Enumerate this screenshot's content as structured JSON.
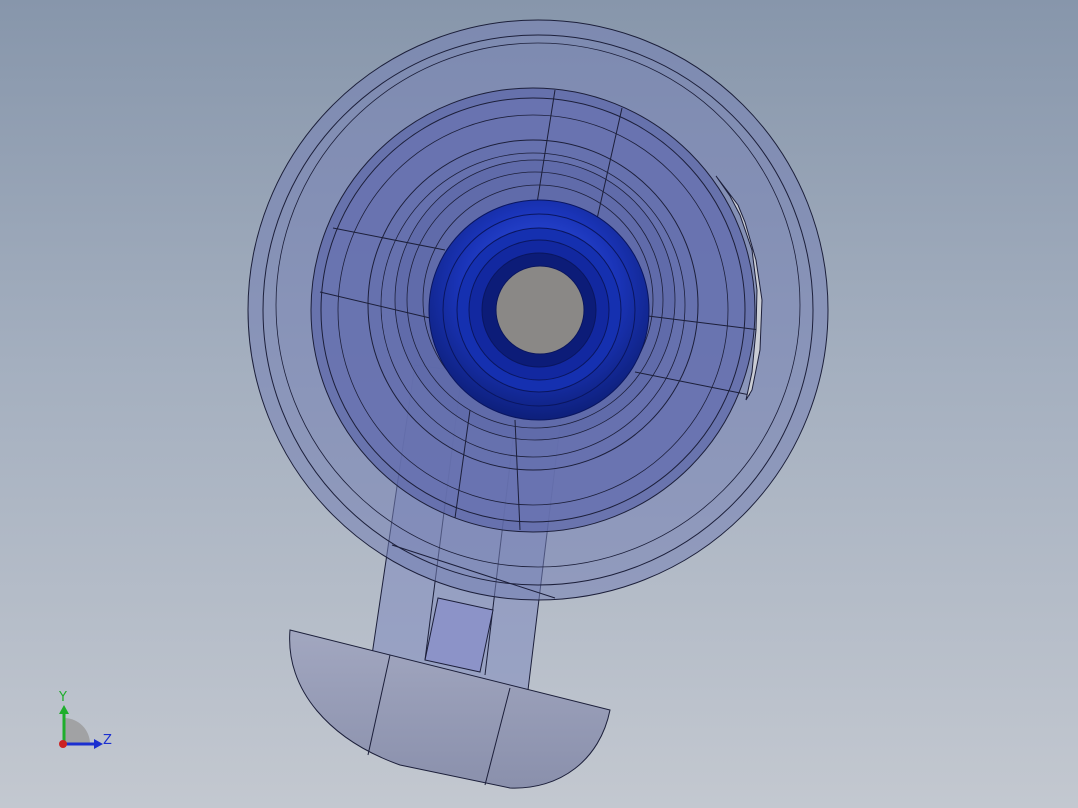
{
  "viewport": {
    "background_top": "#8796ab",
    "background_bottom": "#c3c8d0"
  },
  "model": {
    "shell_color": "#6e7bb4",
    "inner_ring_color": "#5560a8",
    "bore_color": "#1a34b8",
    "hole_color": "#8a8886",
    "edge_color": "#1c1f3a"
  },
  "triad": {
    "y_label": "Y",
    "z_label": "Z",
    "y_color": "#1fae2c",
    "z_color": "#1b2fd0",
    "x_color": "#cc2222"
  }
}
